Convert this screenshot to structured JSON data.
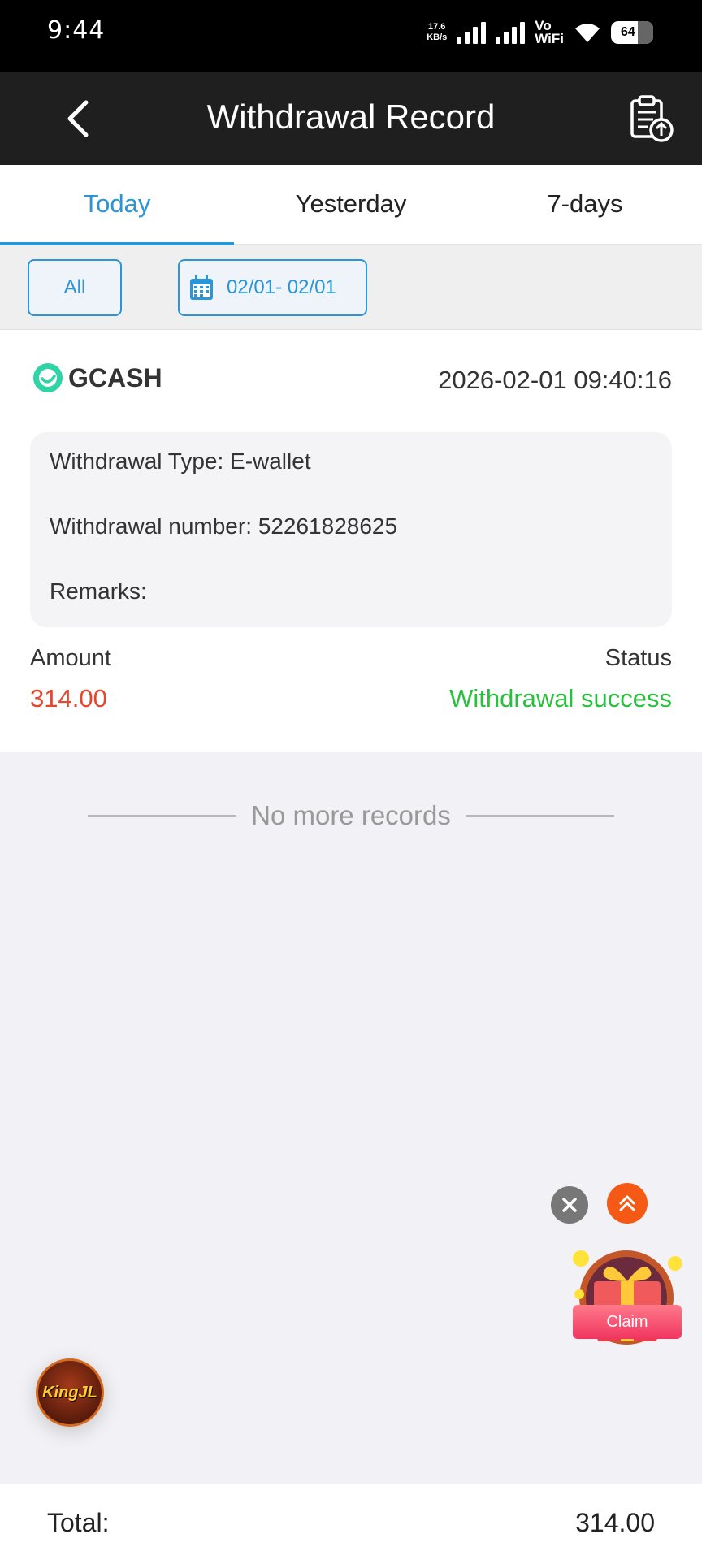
{
  "status_bar": {
    "time": "9:44",
    "net_speed_value": "17.6",
    "net_speed_unit": "KB/s",
    "vowifi_line1": "Vo",
    "vowifi_line2": "WiFi",
    "battery": "64"
  },
  "header": {
    "title": "Withdrawal Record",
    "back_icon": "chevron-left-icon",
    "upload_icon": "clipboard-upload-icon"
  },
  "tabs": [
    {
      "label": "Today",
      "active": true
    },
    {
      "label": "Yesterday",
      "active": false
    },
    {
      "label": "7-days",
      "active": false
    }
  ],
  "filters": {
    "all_label": "All",
    "date_range": "02/01- 02/01",
    "calendar_icon": "calendar-icon"
  },
  "record": {
    "method": "GCASH",
    "datetime": "2026-02-01 09:40:16",
    "withdrawal_type": "Withdrawal Type:  E-wallet",
    "withdrawal_number": "Withdrawal number:  52261828625",
    "remarks": "Remarks:",
    "amount_label": "Amount",
    "amount_value": "314.00",
    "status_label": "Status",
    "status_value": "Withdrawal success"
  },
  "no_more": "No more records",
  "floating": {
    "claim_label": "Claim",
    "badge_text": "KingJL"
  },
  "footer": {
    "total_label": "Total:",
    "total_value": "314.00"
  },
  "colors": {
    "accent": "#2b95d6",
    "amount": "#e5462c",
    "success": "#29c03e",
    "header_bg": "#1f1f1f"
  }
}
